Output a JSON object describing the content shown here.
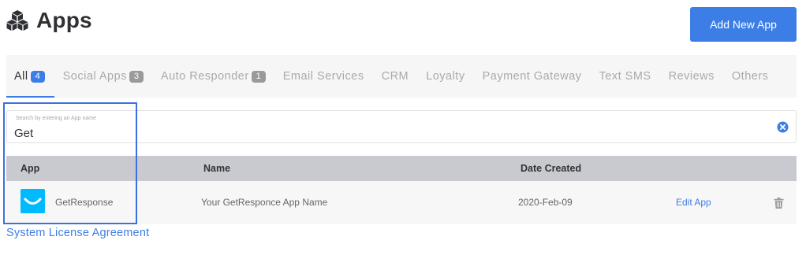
{
  "header": {
    "title": "Apps",
    "icon": "cubes-icon",
    "add_button_label": "Add New App"
  },
  "tabs": [
    {
      "label": "All",
      "count": "4",
      "active": true
    },
    {
      "label": "Social Apps",
      "count": "3"
    },
    {
      "label": "Auto Responder",
      "count": "1"
    },
    {
      "label": "Email Services"
    },
    {
      "label": "CRM"
    },
    {
      "label": "Loyalty"
    },
    {
      "label": "Payment Gateway"
    },
    {
      "label": "Text SMS"
    },
    {
      "label": "Reviews"
    },
    {
      "label": "Others"
    }
  ],
  "search": {
    "label": "Search by entering an App name",
    "value": "Get",
    "clear_icon": "clear-circle-icon"
  },
  "table": {
    "columns": [
      "App",
      "Name",
      "Date Created"
    ],
    "rows": [
      {
        "app": "GetResponse",
        "name": "Your GetResponce App Name",
        "date": "2020-Feb-09",
        "action": "Edit App",
        "delete_icon": "trash-icon"
      }
    ]
  },
  "footer": {
    "link": "System License Agreement"
  },
  "colors": {
    "accent": "#3d7ee6",
    "tab_bar": "#f6f6f6",
    "table_header": "#c8cacf",
    "highlight": "#3d6fe0",
    "getresponse_brand": "#00baff"
  }
}
